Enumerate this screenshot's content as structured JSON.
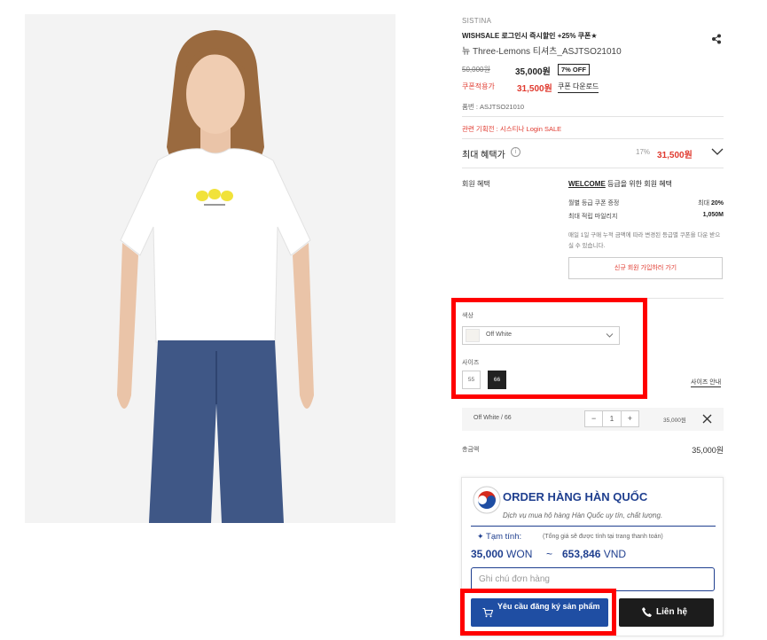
{
  "product": {
    "brand": "SISTINA",
    "promo": "WISHSALE 로그인시 즉시할인 +25% 쿠폰★",
    "name": "뉴 Three-Lemons 티셔츠_ASJTSO21010",
    "original_price": "50,000원",
    "price": "35,000원",
    "discount_badge": "7% OFF",
    "coupon_label": "쿠폰적용가",
    "coupon_price": "31,500원",
    "coupon_download": "쿠폰 다운로드",
    "code": "품번 : ASJTSO21010",
    "related": "관련 기획전 : 시스티나 Login SALE"
  },
  "benefit": {
    "title": "최대 혜택가",
    "percent": "17%",
    "price": "31,500원",
    "member_label": "회원 혜택",
    "welcome_bold": "WELCOME",
    "welcome_rest": " 등급을 위한 회원 혜택",
    "rows": [
      {
        "label": "월별 등급 쿠폰 증정",
        "value_prefix": "최대 ",
        "value": "20%"
      },
      {
        "label": "최대 적립 마일리지",
        "value_prefix": "",
        "value": "1,050M"
      }
    ],
    "note": "매일 1일 구매 누적 금액에 따라 변경된 등급별 쿠폰을 다운 받으실 수 있습니다.",
    "join_button": "신규 회원 가입하러 가기"
  },
  "options": {
    "color_label": "색상",
    "color_value": "Off White",
    "size_label": "사이즈",
    "sizes": [
      "55",
      "66"
    ],
    "selected_size": "66",
    "size_guide": "사이즈 안내"
  },
  "selection": {
    "name": "Off White / 66",
    "minus": "−",
    "qty": "1",
    "plus": "+",
    "price": "35,000원"
  },
  "total": {
    "label": "총금액",
    "value": "35,000원"
  },
  "order": {
    "title": "ORDER HÀNG HÀN QUỐC",
    "subtitle": "Dịch vụ mua hộ hàng Hàn Quốc uy tín, chất lượng.",
    "estimate_label": "Tạm tính:",
    "estimate_note": "(Tổng giá sẽ được tính tại trang thanh toán)",
    "won_value": "35,000",
    "won_unit": " WON",
    "tilde": "~",
    "vnd_value": "653,846",
    "vnd_unit": " VND",
    "note_placeholder": "Ghi chú đơn hàng",
    "request_button": "Yêu cầu đăng ký sản phẩm",
    "contact_button": "Liên hệ"
  },
  "colors": {
    "accent_red": "#e03a2f",
    "order_blue": "#1f3f8f",
    "highlight": "#ff0000"
  }
}
